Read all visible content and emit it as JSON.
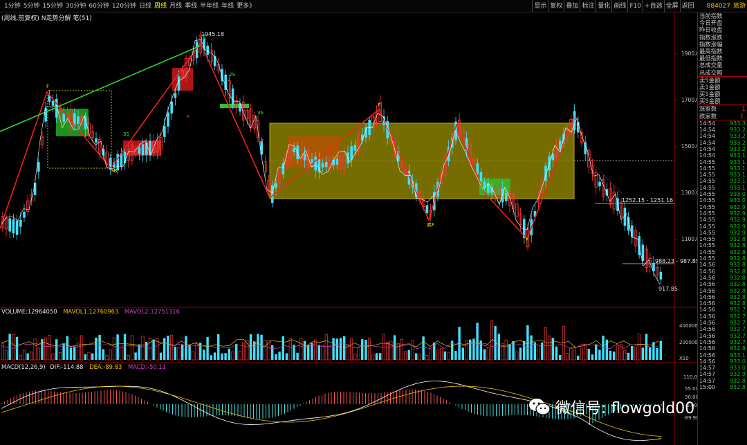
{
  "toolbar": {
    "periods": [
      "1分钟",
      "5分钟",
      "15分钟",
      "30分钟",
      "60分钟",
      "120分钟",
      "日线",
      "周线",
      "月线",
      "季线",
      "半年线",
      "年线",
      "更多》"
    ],
    "active_period": "周线",
    "right_buttons": [
      "显示",
      "复权",
      "叠加",
      "标注",
      "量化",
      "画线",
      "F10",
      "+自选",
      "全屏",
      "返回"
    ],
    "stock_code": "884027",
    "stock_name": "旅游"
  },
  "chart_title": "(周线,前复权) N走势分解  笔(51)",
  "price_axis": [
    "1900.00",
    "1700.00",
    "1500.00",
    "1300.00",
    "1100.00"
  ],
  "annotations": {
    "high_price": "1945.18",
    "low_price": "917.85",
    "range_label_1": "1252.15 - 1251.16",
    "range_label_2": "988.23 - 987.85",
    "markers": [
      "F",
      "3B",
      "3S",
      "1S",
      "2S",
      "3S",
      "F",
      "卖F",
      "F",
      "F",
      "F"
    ]
  },
  "volume": {
    "title": "VOLUME:12964050",
    "mavol1": "MAVOL1:12760963",
    "mavol2": "MAVOL2:12751316",
    "axis": [
      "4000000",
      "2000000",
      "X10"
    ]
  },
  "macd": {
    "title": "MACD(12,26,9)",
    "dif": "DIF:-114.88",
    "dea": "DEA:-89.83",
    "macd": "MACD:-50.11",
    "axis": [
      "110.00",
      "55.00",
      "30.00",
      "-0.00",
      "-89.90"
    ]
  },
  "watermark": "微信号: flowgold00",
  "sidebar": {
    "items": [
      {
        "label": "当前指数",
        "value": ""
      },
      {
        "label": "今日开盘",
        "value": ""
      },
      {
        "label": "昨日收盘",
        "value": ""
      },
      {
        "label": "指数涨跌",
        "value": ""
      },
      {
        "label": "指数涨幅",
        "value": ""
      },
      {
        "label": "最高指数",
        "value": ""
      },
      {
        "label": "最低指数",
        "value": ""
      },
      {
        "label": "总成交量",
        "value": ""
      },
      {
        "label": "总成交额",
        "value": ""
      }
    ],
    "items2": [
      {
        "label": "卖5金额",
        "value": ""
      },
      {
        "label": "卖1金额",
        "value": ""
      },
      {
        "label": "买1金额",
        "value": ""
      },
      {
        "label": "买5金额",
        "value": ""
      }
    ],
    "items3": [
      {
        "label": "涨家数",
        "value": "1"
      },
      {
        "label": "跌家数",
        "value": "1."
      }
    ],
    "ticks": [
      {
        "t": "14:54",
        "p": "933.3"
      },
      {
        "t": "14:54",
        "p": "933.2"
      },
      {
        "t": "14:54",
        "p": "933.2"
      },
      {
        "t": "14:54",
        "p": "933.2"
      },
      {
        "t": "14:54",
        "p": "933.2"
      },
      {
        "t": "14:54",
        "p": "933.1"
      },
      {
        "t": "14:55",
        "p": "933.1"
      },
      {
        "t": "14:55",
        "p": "933.1"
      },
      {
        "t": "14:55",
        "p": "933.1"
      },
      {
        "t": "14:55",
        "p": "933.1"
      },
      {
        "t": "14:55",
        "p": "933.1"
      },
      {
        "t": "14:55",
        "p": "933.0"
      },
      {
        "t": "14:55",
        "p": "933.0"
      },
      {
        "t": "14:55",
        "p": "932.9"
      },
      {
        "t": "14:55",
        "p": "932.9"
      },
      {
        "t": "14:55",
        "p": "932.9"
      },
      {
        "t": "14:55",
        "p": "932.9"
      },
      {
        "t": "14:55",
        "p": "932.9"
      },
      {
        "t": "14:55",
        "p": "932.8"
      },
      {
        "t": "14:55",
        "p": "932.8"
      },
      {
        "t": "14:55",
        "p": "932.8"
      },
      {
        "t": "14:55",
        "p": "932.8"
      },
      {
        "t": "14:56",
        "p": "932.8"
      },
      {
        "t": "14:56",
        "p": "932.8"
      },
      {
        "t": "14:56",
        "p": "932.8"
      },
      {
        "t": "14:56",
        "p": "932.8"
      },
      {
        "t": "14:56",
        "p": "932.8"
      },
      {
        "t": "14:56",
        "p": "932.8"
      },
      {
        "t": "14:56",
        "p": "932.8"
      },
      {
        "t": "14:56",
        "p": "932.7"
      },
      {
        "t": "14:56",
        "p": "932.7"
      },
      {
        "t": "14:56",
        "p": "932.7"
      },
      {
        "t": "14:56",
        "p": "932.7"
      },
      {
        "t": "14:56",
        "p": "932.7"
      },
      {
        "t": "14:56",
        "p": "932.7"
      },
      {
        "t": "14:56",
        "p": "932.8"
      },
      {
        "t": "14:56",
        "p": "933.1"
      },
      {
        "t": "14:56",
        "p": "933.0"
      },
      {
        "t": "14:57",
        "p": "933.0"
      },
      {
        "t": "14:57",
        "p": "932.9"
      },
      {
        "t": "14:57",
        "p": "932.8"
      },
      {
        "t": "15:00",
        "p": "932.8"
      }
    ]
  }
}
